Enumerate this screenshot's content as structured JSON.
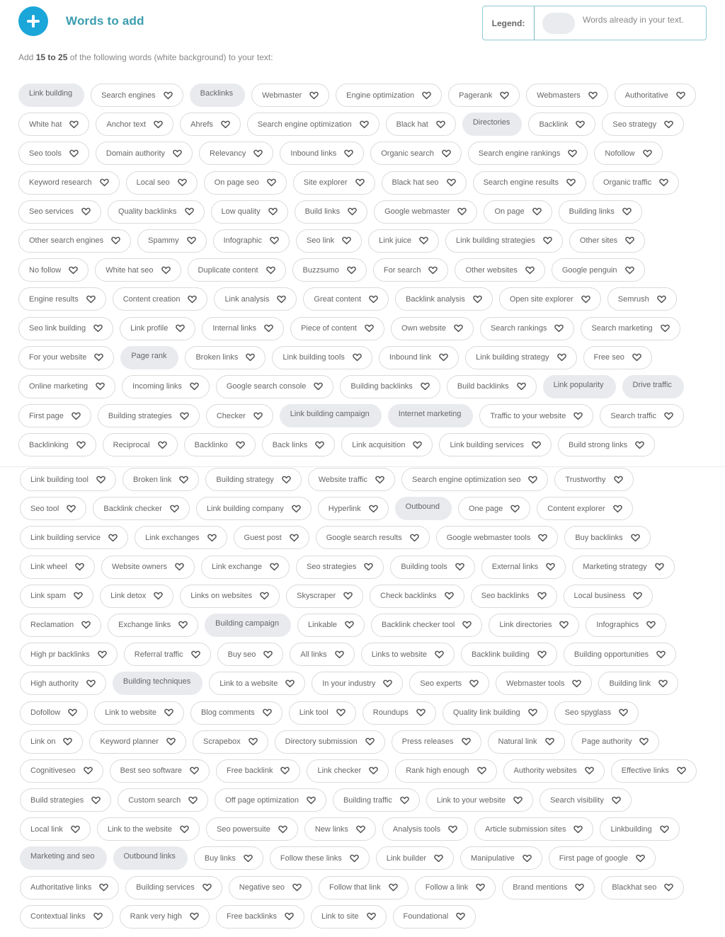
{
  "header": {
    "title": "Words to add",
    "add_icon": "plus-circle-icon"
  },
  "legend": {
    "label": "Legend:",
    "text": "Words already in your text."
  },
  "instruction": {
    "prefix": "Add ",
    "range": "15 to 25",
    "suffix": " of the following words (white background) to your text:"
  },
  "colors": {
    "accent": "#1aa6d9",
    "title": "#3a9dae",
    "present_chip_bg": "#e8eaed",
    "chip_border": "#dadada"
  },
  "rows": [
    [
      {
        "t": "Link building",
        "p": true
      },
      {
        "t": "Search engines"
      },
      {
        "t": "Backlinks",
        "p": true
      },
      {
        "t": "Webmaster"
      },
      {
        "t": "Engine optimization"
      },
      {
        "t": "Pagerank"
      },
      {
        "t": "Webmasters"
      },
      {
        "t": "Authoritative"
      }
    ],
    [
      {
        "t": "White hat"
      },
      {
        "t": "Anchor text"
      },
      {
        "t": "Ahrefs"
      },
      {
        "t": "Search engine optimization"
      },
      {
        "t": "Black hat"
      },
      {
        "t": "Directories",
        "p": true
      },
      {
        "t": "Backlink"
      },
      {
        "t": "Seo strategy"
      }
    ],
    [
      {
        "t": "Seo tools"
      },
      {
        "t": "Domain authority"
      },
      {
        "t": "Relevancy"
      },
      {
        "t": "Inbound links"
      },
      {
        "t": "Organic search"
      },
      {
        "t": "Search engine rankings"
      },
      {
        "t": "Nofollow"
      }
    ],
    [
      {
        "t": "Keyword research"
      },
      {
        "t": "Local seo"
      },
      {
        "t": "On page seo"
      },
      {
        "t": "Site explorer"
      },
      {
        "t": "Black hat seo"
      },
      {
        "t": "Search engine results"
      },
      {
        "t": "Organic traffic"
      }
    ],
    [
      {
        "t": "Seo services"
      },
      {
        "t": "Quality backlinks"
      },
      {
        "t": "Low quality"
      },
      {
        "t": "Build links"
      },
      {
        "t": "Google webmaster"
      },
      {
        "t": "On page"
      },
      {
        "t": "Building links"
      }
    ],
    [
      {
        "t": "Other search engines"
      },
      {
        "t": "Spammy"
      },
      {
        "t": "Infographic"
      },
      {
        "t": "Seo link"
      },
      {
        "t": "Link juice"
      },
      {
        "t": "Link building strategies"
      },
      {
        "t": "Other sites"
      }
    ],
    [
      {
        "t": "No follow"
      },
      {
        "t": "White hat seo"
      },
      {
        "t": "Duplicate content"
      },
      {
        "t": "Buzzsumo"
      },
      {
        "t": "For search"
      },
      {
        "t": "Other websites"
      },
      {
        "t": "Google penguin"
      }
    ],
    [
      {
        "t": "Engine results"
      },
      {
        "t": "Content creation"
      },
      {
        "t": "Link analysis"
      },
      {
        "t": "Great content"
      },
      {
        "t": "Backlink analysis"
      },
      {
        "t": "Open site explorer"
      },
      {
        "t": "Semrush"
      }
    ],
    [
      {
        "t": "Seo link building"
      },
      {
        "t": "Link profile"
      },
      {
        "t": "Internal links"
      },
      {
        "t": "Piece of content"
      },
      {
        "t": "Own website"
      },
      {
        "t": "Search rankings"
      },
      {
        "t": "Search marketing"
      }
    ],
    [
      {
        "t": "For your website"
      },
      {
        "t": "Page rank",
        "p": true
      },
      {
        "t": "Broken links"
      },
      {
        "t": "Link building tools"
      },
      {
        "t": "Inbound link"
      },
      {
        "t": "Link building strategy"
      },
      {
        "t": "Free seo"
      }
    ],
    [
      {
        "t": "Online marketing"
      },
      {
        "t": "Incoming links"
      },
      {
        "t": "Google search console"
      },
      {
        "t": "Building backlinks"
      },
      {
        "t": "Build backlinks"
      },
      {
        "t": "Link popularity",
        "p": true
      },
      {
        "t": "Drive traffic",
        "p": true
      }
    ],
    [
      {
        "t": "First page"
      },
      {
        "t": "Building strategies"
      },
      {
        "t": "Checker"
      },
      {
        "t": "Link building campaign",
        "p": true
      },
      {
        "t": "Internet marketing",
        "p": true
      },
      {
        "t": "Traffic to your website"
      },
      {
        "t": "Search traffic"
      }
    ],
    [
      {
        "t": "Backlinking"
      },
      {
        "t": "Reciprocal"
      },
      {
        "t": "Backlinko"
      },
      {
        "t": "Back links"
      },
      {
        "t": "Link acquisition"
      },
      {
        "t": "Link building services"
      },
      {
        "t": "Build strong links"
      }
    ]
  ],
  "rows2": [
    [
      {
        "t": "Link building tool"
      },
      {
        "t": "Broken link"
      },
      {
        "t": "Building strategy"
      },
      {
        "t": "Website traffic"
      },
      {
        "t": "Search engine optimization seo"
      },
      {
        "t": "Trustworthy"
      }
    ],
    [
      {
        "t": "Seo tool"
      },
      {
        "t": "Backlink checker"
      },
      {
        "t": "Link building company"
      },
      {
        "t": "Hyperlink"
      },
      {
        "t": "Outbound",
        "p": true
      },
      {
        "t": "One page"
      },
      {
        "t": "Content explorer"
      }
    ],
    [
      {
        "t": "Link building service"
      },
      {
        "t": "Link exchanges"
      },
      {
        "t": "Guest post"
      },
      {
        "t": "Google search results"
      },
      {
        "t": "Google webmaster tools"
      },
      {
        "t": "Buy backlinks"
      }
    ],
    [
      {
        "t": "Link wheel"
      },
      {
        "t": "Website owners"
      },
      {
        "t": "Link exchange"
      },
      {
        "t": "Seo strategies"
      },
      {
        "t": "Building tools"
      },
      {
        "t": "External links"
      },
      {
        "t": "Marketing strategy"
      }
    ],
    [
      {
        "t": "Link spam"
      },
      {
        "t": "Link detox"
      },
      {
        "t": "Links on websites"
      },
      {
        "t": "Skyscraper"
      },
      {
        "t": "Check backlinks"
      },
      {
        "t": "Seo backlinks"
      },
      {
        "t": "Local business"
      }
    ],
    [
      {
        "t": "Reclamation"
      },
      {
        "t": "Exchange links"
      },
      {
        "t": "Building campaign",
        "p": true
      },
      {
        "t": "Linkable"
      },
      {
        "t": "Backlink checker tool"
      },
      {
        "t": "Link directories"
      },
      {
        "t": "Infographics"
      }
    ],
    [
      {
        "t": "High pr backlinks"
      },
      {
        "t": "Referral traffic"
      },
      {
        "t": "Buy seo"
      },
      {
        "t": "All links"
      },
      {
        "t": "Links to website"
      },
      {
        "t": "Backlink building"
      },
      {
        "t": "Building opportunities"
      }
    ],
    [
      {
        "t": "High authority"
      },
      {
        "t": "Building techniques",
        "p": true
      },
      {
        "t": "Link to a website"
      },
      {
        "t": "In your industry"
      },
      {
        "t": "Seo experts"
      },
      {
        "t": "Webmaster tools"
      },
      {
        "t": "Building link"
      }
    ],
    [
      {
        "t": "Dofollow"
      },
      {
        "t": "Link to website"
      },
      {
        "t": "Blog comments"
      },
      {
        "t": "Link tool"
      },
      {
        "t": "Roundups"
      },
      {
        "t": "Quality link building"
      },
      {
        "t": "Seo spyglass"
      }
    ],
    [
      {
        "t": "Link on"
      },
      {
        "t": "Keyword planner"
      },
      {
        "t": "Scrapebox"
      },
      {
        "t": "Directory submission"
      },
      {
        "t": "Press releases"
      },
      {
        "t": "Natural link"
      },
      {
        "t": "Page authority"
      }
    ],
    [
      {
        "t": "Cognitiveseo"
      },
      {
        "t": "Best seo software"
      },
      {
        "t": "Free backlink"
      },
      {
        "t": "Link checker"
      },
      {
        "t": "Rank high enough"
      },
      {
        "t": "Authority websites"
      },
      {
        "t": "Effective links"
      }
    ],
    [
      {
        "t": "Build strategies"
      },
      {
        "t": "Custom search"
      },
      {
        "t": "Off page optimization"
      },
      {
        "t": "Building traffic"
      },
      {
        "t": "Link to your website"
      },
      {
        "t": "Search visibility"
      }
    ],
    [
      {
        "t": "Local link"
      },
      {
        "t": "Link to the website"
      },
      {
        "t": "Seo powersuite"
      },
      {
        "t": "New links"
      },
      {
        "t": "Analysis tools"
      },
      {
        "t": "Article submission sites"
      },
      {
        "t": "Linkbuilding"
      }
    ],
    [
      {
        "t": "Marketing and seo",
        "p": true
      },
      {
        "t": "Outbound links",
        "p": true
      },
      {
        "t": "Buy links"
      },
      {
        "t": "Follow these links"
      },
      {
        "t": "Link builder"
      },
      {
        "t": "Manipulative"
      },
      {
        "t": "First page of google"
      }
    ],
    [
      {
        "t": "Authoritative links"
      },
      {
        "t": "Building services"
      },
      {
        "t": "Negative seo"
      },
      {
        "t": "Follow that link"
      },
      {
        "t": "Follow a link"
      },
      {
        "t": "Brand mentions"
      },
      {
        "t": "Blackhat seo"
      }
    ],
    [
      {
        "t": "Contextual links"
      },
      {
        "t": "Rank very high"
      },
      {
        "t": "Free backlinks"
      },
      {
        "t": "Link to site"
      },
      {
        "t": "Foundational"
      }
    ]
  ]
}
